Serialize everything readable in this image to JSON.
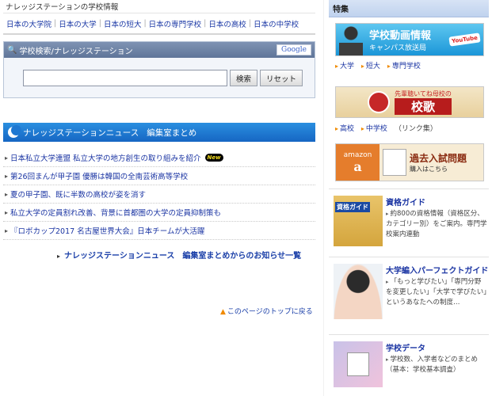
{
  "school_info": {
    "heading": "ナレッジステーションの学校情報",
    "links": [
      "日本の大学院",
      "日本の大学",
      "日本の短大",
      "日本の専門学校",
      "日本の高校",
      "日本の中学校"
    ]
  },
  "search": {
    "title": "学校検索/ナレッジステーション",
    "google_label": "Google",
    "input_value": "",
    "search_button": "検索",
    "reset_button": "リセット"
  },
  "news": {
    "title": "ナレッジステーションニュース",
    "subtitle": "編集室まとめ",
    "new_badge": "New",
    "items": [
      "日本私立大学連盟 私立大学の地方創生の取り組みを紹介",
      "第26回まんが甲子園 優勝は韓国の全南芸術高等学校",
      "夏の甲子園、既に半数の高校が姿を消す",
      "私立大学の定員割れ改善、背景に首都圏の大学の定員抑制策も",
      "『ロボカップ2017 名古屋世界大会』日本チームが大活躍"
    ],
    "more_link": "ナレッジステーションニュース　編集室まとめからのお知らせ一覧",
    "page_top": "このページのトップに戻る"
  },
  "sidebar": {
    "heading": "特集",
    "video_banner": {
      "title": "学校動画情報",
      "subtitle": "キャンパス放送局",
      "badge": "YouTube"
    },
    "video_links": [
      "大学",
      "短大",
      "専門学校"
    ],
    "song_banner": {
      "line1": "先輩聴いてね母校の",
      "line2": "校歌"
    },
    "song_links": [
      "高校",
      "中学校",
      "（リンク集）"
    ],
    "exam_banner": {
      "amazon": "amazon",
      "amazon_mark": "a",
      "title": "過去入試問題",
      "subtitle": "購入はこちら"
    },
    "cards": [
      {
        "image_label": "資格ガイド",
        "title": "資格ガイド",
        "desc": "約800の資格情報（資格区分、カテゴリー別）をご案内。専門学校案内連動"
      },
      {
        "title": "大学編入パーフェクトガイド",
        "desc": "「もっと学びたい」「専門分野を変更したい」「大学で学びたい」というあなたへの制度…"
      },
      {
        "title": "学校データ",
        "desc": "学校数、入学者などのまとめ（基本：学校基本調査）"
      }
    ]
  }
}
